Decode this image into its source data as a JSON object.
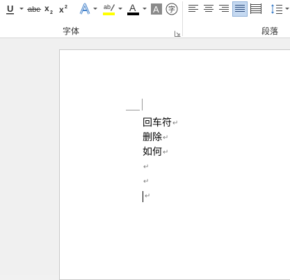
{
  "ribbon": {
    "font_group": {
      "label": "字体",
      "underline_glyph": "U",
      "strikethrough_glyph": "abc",
      "subscript_glyph": "x",
      "subscript_sub": "2",
      "superscript_glyph": "x",
      "superscript_sup": "2",
      "font_color_glyph": "A",
      "char_shading_glyph": "A",
      "enclose_glyph": "字",
      "highlight_color": "#ffff00",
      "font_color": "#000000"
    },
    "paragraph_group": {
      "label": "段落"
    },
    "accent_color": "#2b579a"
  },
  "document": {
    "lines": [
      {
        "text": "回车符"
      },
      {
        "text": "删除"
      },
      {
        "text": "如何"
      },
      {
        "text": ""
      },
      {
        "text": ""
      },
      {
        "text": ""
      }
    ],
    "paragraph_mark": "↵"
  }
}
